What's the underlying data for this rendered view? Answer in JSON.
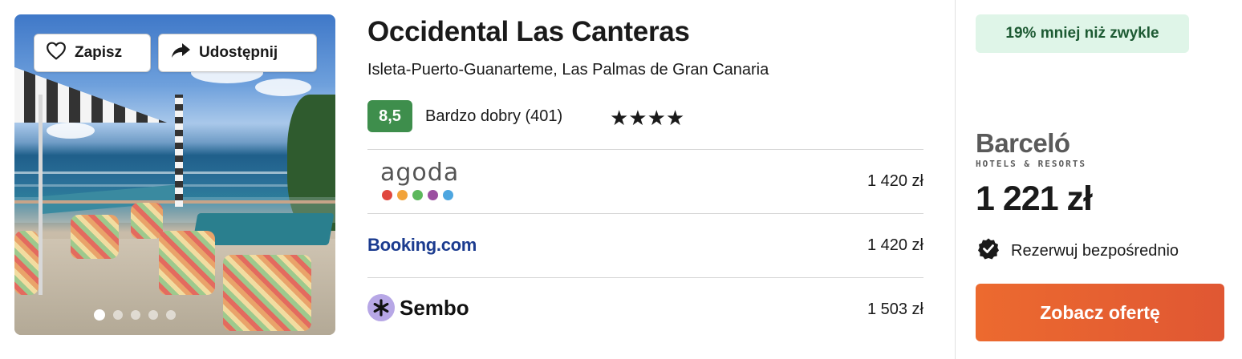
{
  "photo": {
    "save_label": "Zapisz",
    "share_label": "Udostępnij",
    "slide_count": 5,
    "active_slide": 1
  },
  "hotel": {
    "name": "Occidental Las Canteras",
    "location": "Isleta-Puerto-Guanarteme, Las Palmas de Gran Canaria",
    "rating_score": "8,5",
    "rating_text": "Bardzo dobry (401)",
    "stars_text": "★★★★"
  },
  "offers": [
    {
      "provider": "agoda",
      "price": "1 420 zł"
    },
    {
      "provider": "Booking.com",
      "price": "1 420 zł"
    },
    {
      "provider": "Sembo",
      "price": "1 503 zł"
    }
  ],
  "featured": {
    "discount_label": "19% mniej niż zwykle",
    "brand_name": "Barceló",
    "brand_sub": "HOTELS & RESORTS",
    "price": "1 221 zł",
    "direct_label": "Rezerwuj bezpośrednio",
    "cta_label": "Zobacz ofertę"
  },
  "colors": {
    "rating_green": "#3e8e4c",
    "cta_orange": "#e8622f",
    "discount_bg": "#dff5e8",
    "booking_blue": "#1b3b8f",
    "agoda_dots": [
      "#e0473e",
      "#f2a33a",
      "#5cb85c",
      "#9b4fa0",
      "#4da6e0"
    ]
  },
  "icons": {
    "save": "heart-icon",
    "share": "share-arrow-icon",
    "direct": "verified-badge-icon"
  }
}
